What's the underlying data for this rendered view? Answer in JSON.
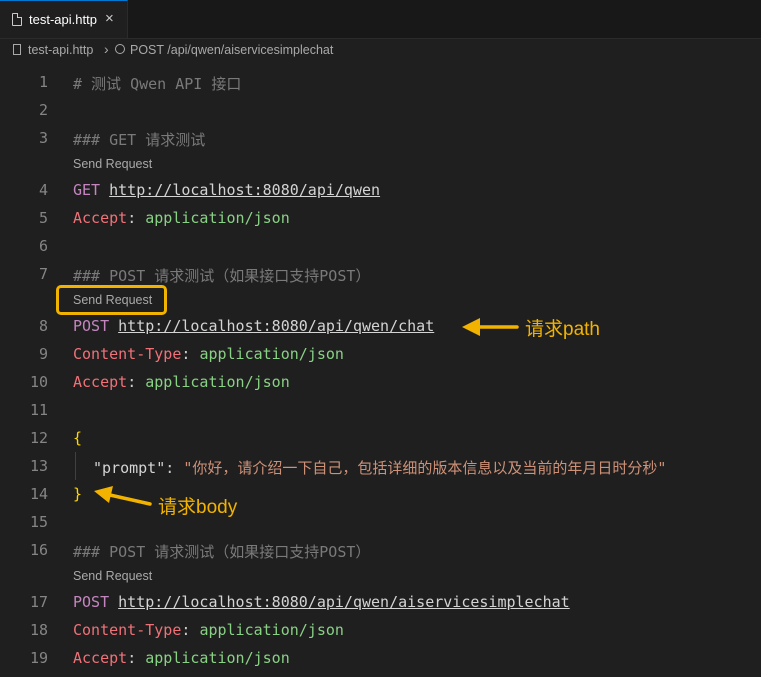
{
  "tab": {
    "label": "test-api.http",
    "close": "×"
  },
  "breadcrumb": {
    "file": "test-api.http",
    "separator": "›",
    "symbol": "POST /api/qwen/aiservicesimplechat"
  },
  "code_lens": "Send Request",
  "lines": {
    "l1": {
      "num": "1",
      "text": "# 测试 Qwen API 接口"
    },
    "l2": {
      "num": "2"
    },
    "l3": {
      "num": "3",
      "text": "### GET 请求测试"
    },
    "l4": {
      "num": "4",
      "method": "GET",
      "url": "http://localhost:8080/api/qwen"
    },
    "l5": {
      "num": "5",
      "name": "Accept",
      "value": "application/json"
    },
    "l6": {
      "num": "6"
    },
    "l7": {
      "num": "7",
      "text": "### POST 请求测试（如果接口支持POST）"
    },
    "l8": {
      "num": "8",
      "method": "POST",
      "url": "http://localhost:8080/api/qwen/chat"
    },
    "l9": {
      "num": "9",
      "name": "Content-Type",
      "value": "application/json"
    },
    "l10": {
      "num": "10",
      "name": "Accept",
      "value": "application/json"
    },
    "l11": {
      "num": "11"
    },
    "l12": {
      "num": "12",
      "text": "{"
    },
    "l13": {
      "num": "13",
      "key": "\"prompt\"",
      "value": "\"你好，请介绍一下自己，包括详细的版本信息以及当前的年月日时分秒\""
    },
    "l14": {
      "num": "14",
      "text": "}"
    },
    "l15": {
      "num": "15"
    },
    "l16": {
      "num": "16",
      "text": "### POST 请求测试（如果接口支持POST）"
    },
    "l17": {
      "num": "17",
      "method": "POST",
      "url": "http://localhost:8080/api/qwen/aiservicesimplechat"
    },
    "l18": {
      "num": "18",
      "name": "Content-Type",
      "value": "application/json"
    },
    "l19": {
      "num": "19",
      "name": "Accept",
      "value": "application/json"
    }
  },
  "annotations": {
    "path": "请求path",
    "body": "请求body"
  },
  "colors": {
    "highlight": "#f2b300",
    "keyword": "#c586c0",
    "header_name": "#f07178",
    "header_value": "#89d185",
    "brace": "#ffd700",
    "string": "#ce9178"
  }
}
